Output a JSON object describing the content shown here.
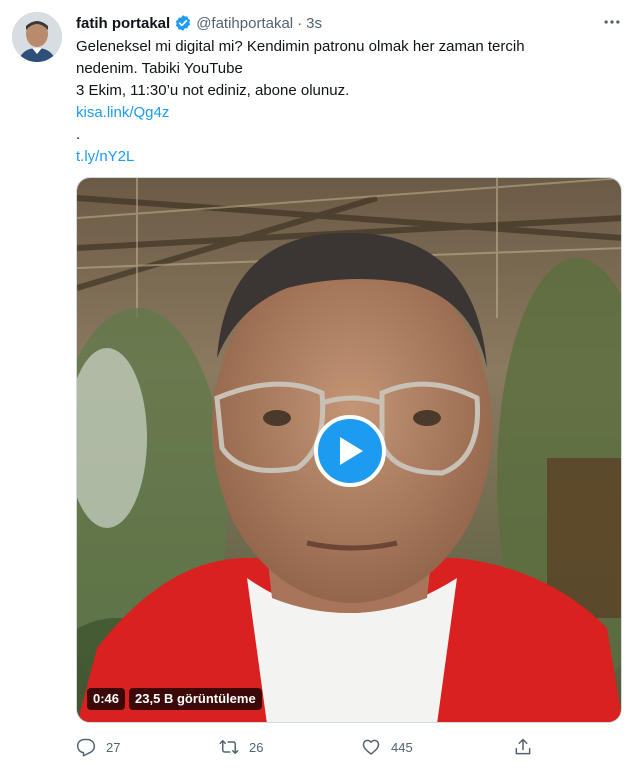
{
  "tweet": {
    "display_name": "fatih portakal",
    "handle": "@fatihportakal",
    "separator": "·",
    "time": "3s",
    "text_lines": [
      "Geleneksel mi digital mi? Kendimin patronu olmak her zaman tercih",
      "nedenim. Tabiki YouTube",
      "3 Ekim, 11:30’u not ediniz, abone olunuz."
    ],
    "links": [
      "kisa.link/Qg4z",
      "t.ly/nY2L"
    ],
    "dot_line": ".",
    "verified_icon": "verified-badge-icon",
    "more_icon": "more-horizontal-icon"
  },
  "media": {
    "duration": "0:46",
    "views": "23,5 B görüntüleme",
    "play_icon": "play-icon"
  },
  "actions": {
    "reply_count": "27",
    "retweet_count": "26",
    "like_count": "445",
    "reply_icon": "reply-icon",
    "retweet_icon": "retweet-icon",
    "like_icon": "heart-icon",
    "share_icon": "share-icon"
  },
  "colors": {
    "accent": "#1d9bf0",
    "text": "#0f1419",
    "muted": "#536471"
  }
}
